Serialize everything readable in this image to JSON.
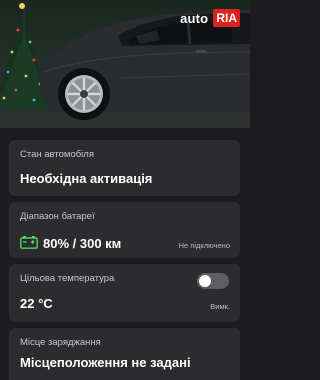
{
  "brand": {
    "name_part1": "auto",
    "name_part2": "RIA"
  },
  "cards": {
    "car_status": {
      "label": "Стан автомобіля",
      "value": "Необхідна активація"
    },
    "battery": {
      "label": "Діапазон батареї",
      "value": "80% / 300 км",
      "status": "Не підключено",
      "icon": "battery-charging-icon"
    },
    "temperature": {
      "label": "Цільова температура",
      "value": "22 °C",
      "toggle_state": "Вимк.",
      "toggle_on": false
    },
    "charging_place": {
      "label": "Місце заряджання",
      "value": "Місцеположення не задані"
    }
  },
  "colors": {
    "background": "#1c1c1e",
    "card": "#2c2c2e",
    "battery_green": "#4cd964",
    "brand_red": "#d9231d"
  }
}
